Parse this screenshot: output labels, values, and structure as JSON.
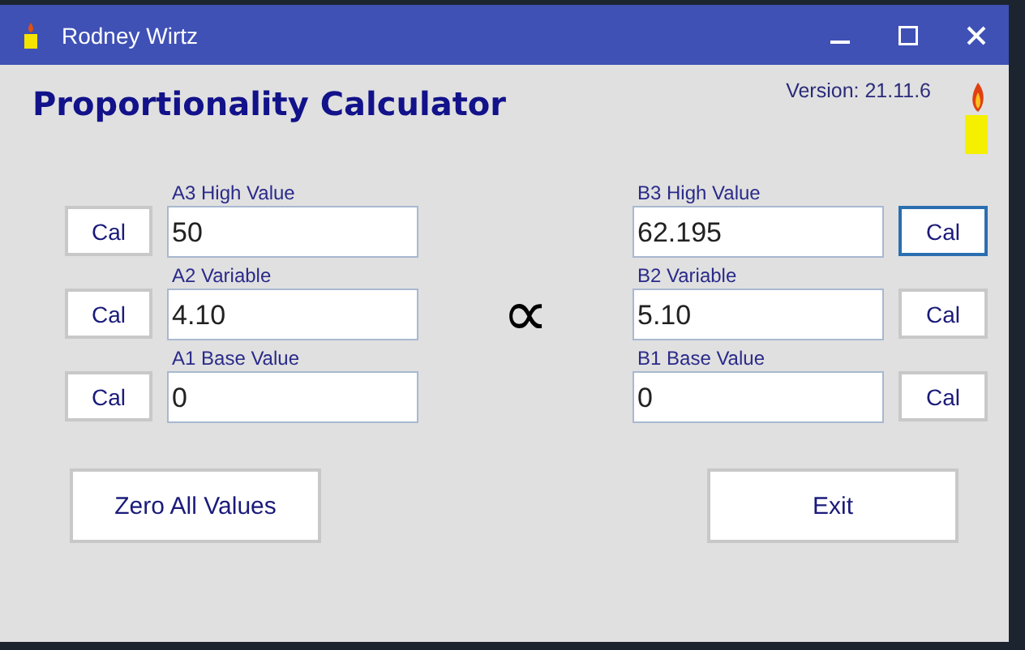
{
  "window": {
    "title": "Rodney Wirtz"
  },
  "heading": "Proportionality Calculator",
  "version": "Version: 21.11.6",
  "symbol": "∝",
  "left": [
    {
      "label": "A3 High Value",
      "value": "50",
      "cal": {
        "label": "Cal",
        "focused": false
      }
    },
    {
      "label": "A2 Variable",
      "value": "4.10",
      "cal": {
        "label": "Cal",
        "focused": false
      }
    },
    {
      "label": "A1 Base Value",
      "value": "0",
      "cal": {
        "label": "Cal",
        "focused": false
      }
    }
  ],
  "right": [
    {
      "label": "B3 High Value",
      "value": "62.195",
      "cal": {
        "label": "Cal",
        "focused": true
      }
    },
    {
      "label": "B2 Variable",
      "value": "5.10",
      "cal": {
        "label": "Cal",
        "focused": false
      }
    },
    {
      "label": "B1 Base Value",
      "value": "0",
      "cal": {
        "label": "Cal",
        "focused": false
      }
    }
  ],
  "buttons": [
    "Zero All Values",
    "Exit"
  ]
}
